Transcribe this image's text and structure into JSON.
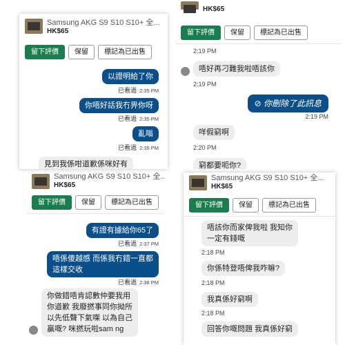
{
  "listing": {
    "title": "Samsung AKG S9 S10 S10+ 全...",
    "price": "HK$65"
  },
  "actions": {
    "review": "留下評價",
    "reserve": "保留",
    "mark_sold": "標記為已出售"
  },
  "seen": "已看過",
  "deleted_icon": "⊘",
  "p1": {
    "messages": [
      "以證明給了你",
      "你唔好話我冇畀你呀",
      "亂嗡",
      "見到我係咁道歉係咪好有"
    ],
    "times": [
      "2:35 PM",
      "2:35 PM",
      "2:35 PM"
    ]
  },
  "p2": {
    "time_top": "2:19 PM",
    "m1": "唔好再刁難我啦唔該你",
    "t1": "2:19 PM",
    "deleted": "你刪除了此訊息",
    "t2": "2:19 PM",
    "m2": "咩假窮啊",
    "t3": "2:20 PM",
    "m3": "窮都要呃你?"
  },
  "p3": {
    "m1": "有證有據給你65了",
    "t1": "2:37 PM",
    "m2a": "唔係傻越感 而係我冇錯一直都",
    "m2b": "這樣交收",
    "t2": "2:38 PM",
    "m3a": "你做錯唔肯認數仲要我用",
    "m3b": "你道歉 我廢撚事同你拗所",
    "m3c": "以先低聲下氣㗎 以為自己",
    "m3d": "贏嘅? 咪撚玩啦sam ng"
  },
  "p4": {
    "m1a": "唔該你而家俾我啦 我知你",
    "m1b": "一定有錢嘅",
    "t1": "2:18 PM",
    "m2": "你係特登唔俾我咋嘛?",
    "t2": "2:18 PM",
    "m3": "我真係好窮啊",
    "t3": "2:18 PM",
    "m4": "回答你嘅問題 我真係好窮"
  }
}
